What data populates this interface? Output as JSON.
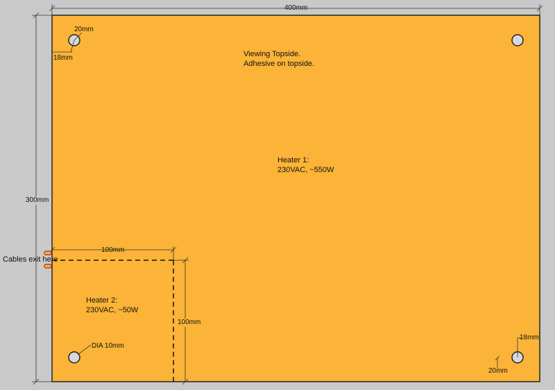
{
  "colors": {
    "background": "#c9c9c9",
    "plate": "#fbb437",
    "line": "#222222",
    "hole_fill": "#d8d8d8"
  },
  "dimensions": {
    "width": "400mm",
    "height": "300mm",
    "hole_offset_x": "20mm",
    "hole_offset_y": "18mm",
    "heater2_width": "100mm",
    "heater2_height": "100mm",
    "hole_diameter": "DIA 10mm"
  },
  "notes": {
    "view_line1": "Viewing Topside.",
    "view_line2": "Adhesive on topside.",
    "cables": "Cables exit here"
  },
  "heaters": [
    {
      "title": "Heater 1:",
      "spec": "230VAC, ~550W"
    },
    {
      "title": "Heater 2:",
      "spec": "230VAC, ~50W"
    }
  ],
  "holes": [
    {
      "icon": "mounting-hole-icon"
    },
    {
      "icon": "mounting-hole-icon"
    },
    {
      "icon": "mounting-hole-icon"
    },
    {
      "icon": "mounting-hole-icon"
    }
  ]
}
